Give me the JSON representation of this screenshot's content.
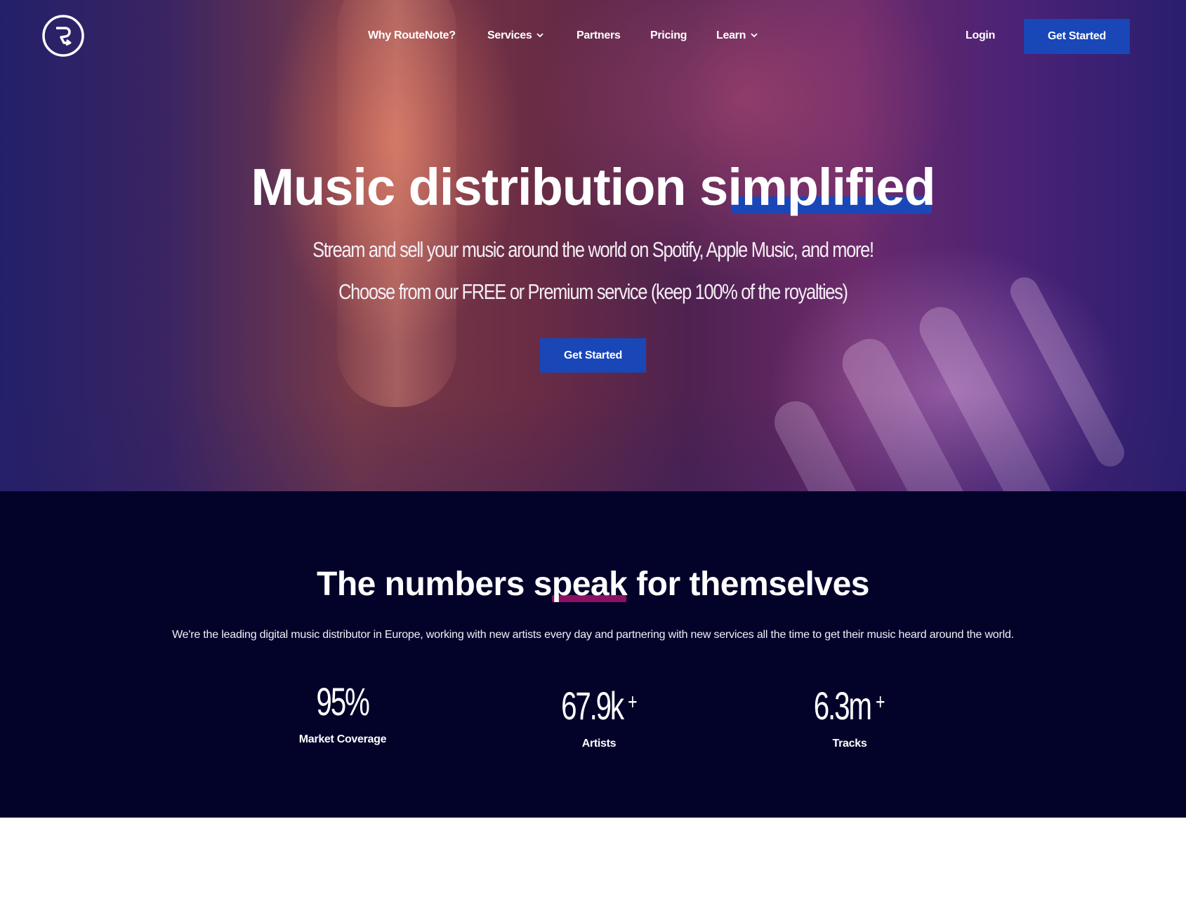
{
  "brand": {
    "name": "RouteNote",
    "logo_icon": "routenote-logo-icon",
    "accent": "#1947b8",
    "highlight_pink": "#8a1162",
    "dark_bg": "#03032a"
  },
  "nav": {
    "items": [
      {
        "label": "Why RouteNote?",
        "has_dropdown": false
      },
      {
        "label": "Services",
        "has_dropdown": true
      },
      {
        "label": "Partners",
        "has_dropdown": false
      },
      {
        "label": "Pricing",
        "has_dropdown": false
      },
      {
        "label": "Learn",
        "has_dropdown": true
      }
    ],
    "login_label": "Login",
    "cta_label": "Get Started"
  },
  "hero": {
    "headline_prefix": "Music distribution si",
    "headline_highlight": "mplified",
    "subtitle_1": "Stream and sell your music around the world on Spotify, Apple Music, and more!",
    "subtitle_2": "Choose from our FREE or Premium service (keep 100% of the royalties)",
    "cta_label": "Get Started"
  },
  "stats": {
    "title_prefix": "The numbers ",
    "title_highlight": "speak",
    "title_suffix": " for themselves",
    "description": "We're the leading digital music distributor in Europe, working with new artists every day and partnering with new services all the time to get their music heard around the world.",
    "items": [
      {
        "value": "95%",
        "suffix": "",
        "label": "Market Coverage"
      },
      {
        "value": "67.9k",
        "suffix": "+",
        "label": "Artists"
      },
      {
        "value": "6.3m",
        "suffix": "+",
        "label": "Tracks"
      }
    ]
  }
}
